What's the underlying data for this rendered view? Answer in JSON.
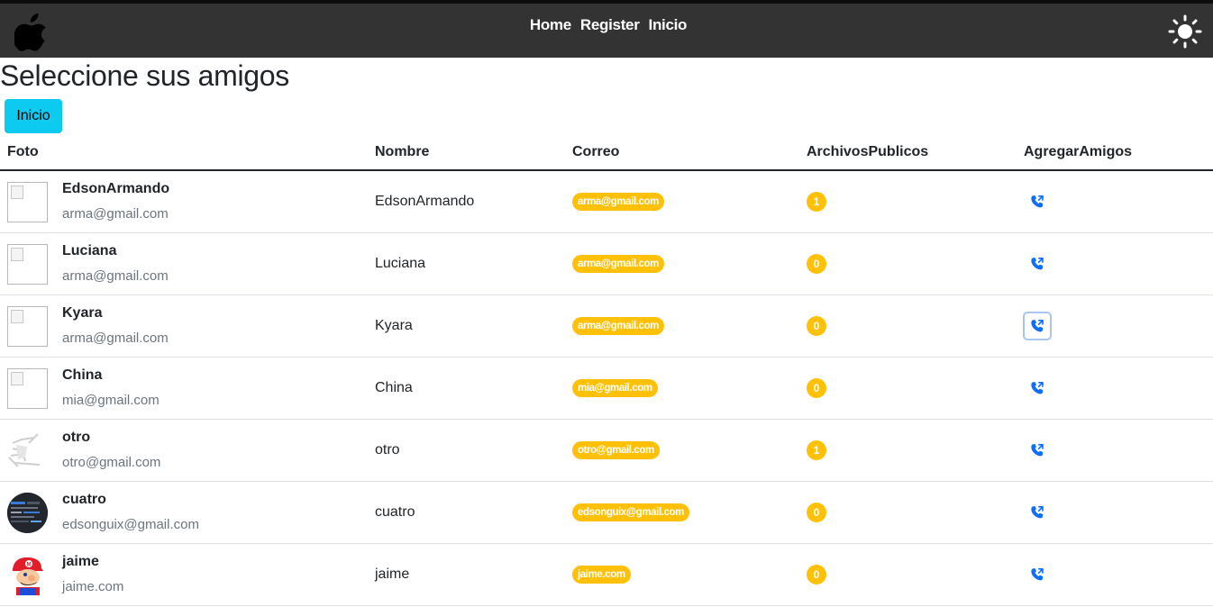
{
  "nav": {
    "links": [
      "Home",
      "Register",
      "Inicio"
    ]
  },
  "page_title": "Seleccione sus amigos",
  "inicio_button": "Inicio",
  "table": {
    "headers": [
      "Foto",
      "Nombre",
      "Correo",
      "ArchivosPublicos",
      "AgregarAmigos"
    ],
    "rows": [
      {
        "name": "EdsonArmando",
        "email": "arma@gmail.com",
        "nombre": "EdsonArmando",
        "correo": "arma@gmail.com",
        "archivos": "1",
        "photo": "broken"
      },
      {
        "name": "Luciana",
        "email": "arma@gmail.com",
        "nombre": "Luciana",
        "correo": "arma@gmail.com",
        "archivos": "0",
        "photo": "broken"
      },
      {
        "name": "Kyara",
        "email": "arma@gmail.com",
        "nombre": "Kyara",
        "correo": "arma@gmail.com",
        "archivos": "0",
        "photo": "broken"
      },
      {
        "name": "China",
        "email": "mia@gmail.com",
        "nombre": "China",
        "correo": "mia@gmail.com",
        "archivos": "0",
        "photo": "broken"
      },
      {
        "name": "otro",
        "email": "otro@gmail.com",
        "nombre": "otro",
        "correo": "otro@gmail.com",
        "archivos": "1",
        "photo": "sketch"
      },
      {
        "name": "cuatro",
        "email": "edsonguix@gmail.com",
        "nombre": "cuatro",
        "correo": "edsonguix@gmail.com",
        "archivos": "0",
        "photo": "dark"
      },
      {
        "name": "jaime",
        "email": "jaime.com",
        "nombre": "jaime",
        "correo": "jaime.com",
        "archivos": "0",
        "photo": "mario"
      }
    ]
  },
  "icons": {
    "logo": "apple-icon",
    "theme": "sun-icon",
    "add_friend": "phone-add-icon"
  },
  "colors": {
    "navbar": "#333333",
    "info": "#0dcaf0",
    "warning": "#ffc107",
    "primary": "#0d6efd"
  },
  "focused_row": 2
}
